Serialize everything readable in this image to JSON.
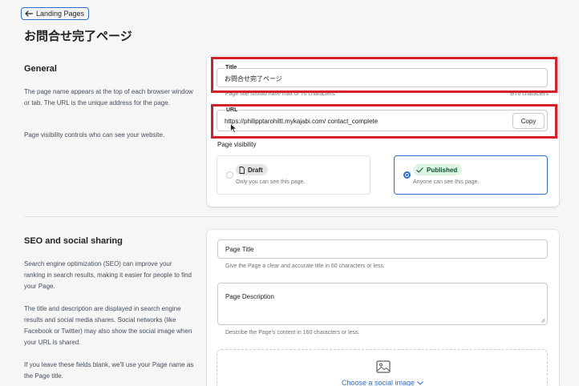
{
  "back_button": {
    "label": "Landing Pages"
  },
  "page_title": "お問合せ完了ページ",
  "general": {
    "heading": "General",
    "description_1": "The page name appears at the top of each browser window or tab. The URL is the unique address for the page.",
    "description_2": "Page visibility controls who can see your website.",
    "title_field": {
      "label": "Title",
      "value": "お問合せ完了ページ",
      "help": "Page title should have max of 70 characters.",
      "count": "9/70 characters"
    },
    "url_field": {
      "label": "URL",
      "value": "https://philipptarohiltl.mykajabi.com/ contact_complete",
      "copy_label": "Copy"
    },
    "visibility": {
      "label": "Page visibility",
      "options": [
        {
          "badge": "Draft",
          "sub": "Only you can see this page.",
          "selected": false
        },
        {
          "badge": "Published",
          "sub": "Anyone can see this page.",
          "selected": true
        }
      ]
    }
  },
  "seo": {
    "heading": "SEO and social sharing",
    "description_1": "Search engine optimization (SEO) can improve your ranking in search results, making it easier for people to find your Page.",
    "description_2": "The title and description are displayed in search engine results and social media shares. Social networks (like Facebook or Twitter) may also show the social image when your URL is shared.",
    "description_3": "If you leave these fields blank, we'll use your Page name as the Page title.",
    "page_title_field": {
      "placeholder": "Page Title",
      "help": "Give the Page a clear and accurate title in 60 characters or less."
    },
    "page_description_field": {
      "placeholder": "Page Description",
      "help": "Describe the Page's content in 160 characters or less."
    },
    "social_image": {
      "link": "Choose a social image"
    }
  },
  "colors": {
    "accent": "#2c6ecb",
    "highlight": "#d61f26",
    "published_badge": "#dff5e4",
    "draft_badge": "#e4e5e7"
  }
}
